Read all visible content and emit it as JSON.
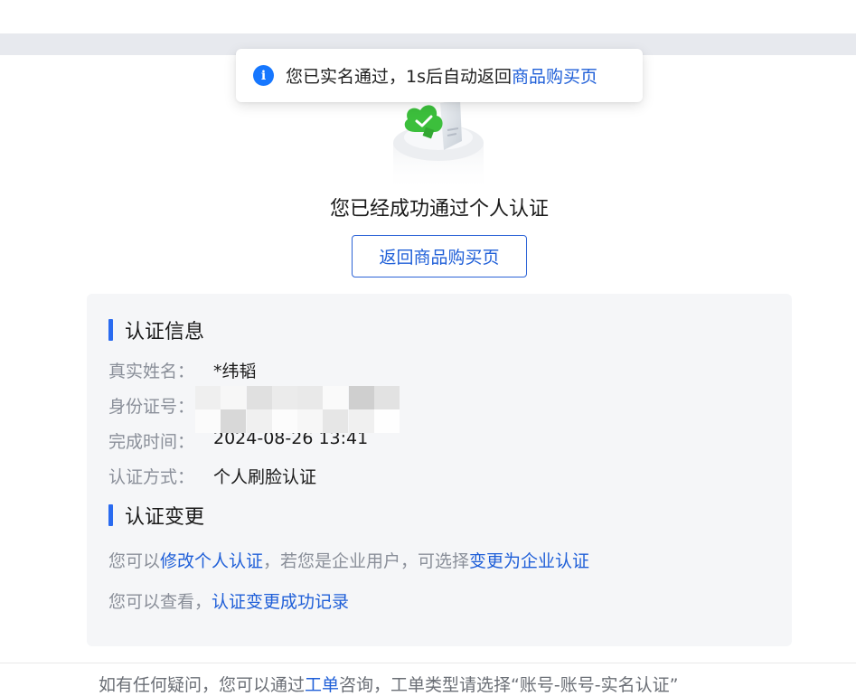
{
  "toast": {
    "message": "您已实名通过，1s后自动返回",
    "link": "商品购买页",
    "icon": "info-icon"
  },
  "illustration": {
    "icon": "verified-shield-cloud-icon",
    "accent": "#3cbf3c"
  },
  "success": {
    "title": "您已经成功通过个人认证",
    "back_button": "返回商品购买页"
  },
  "auth_info": {
    "title": "认证信息",
    "rows": [
      {
        "label": "真实姓名：",
        "value": "*纬韬"
      },
      {
        "label": "身份证号：",
        "value": ""
      },
      {
        "label": "完成时间：",
        "value": "2024-08-26 13:41"
      },
      {
        "label": "认证方式：",
        "value": "个人刷脸认证"
      }
    ]
  },
  "auth_change": {
    "title": "认证变更",
    "line1_prefix": "您可以",
    "line1_link1": "修改个人认证",
    "line1_middle": "，若您是企业用户，可选择",
    "line1_link2": "变更为企业认证",
    "line2_prefix": "您可以查看，",
    "line2_link": "认证变更成功记录"
  },
  "footer": {
    "prefix": "如有任何疑问，您可以通过",
    "link": "工单",
    "suffix": "咨询，工单类型请选择“账号-账号-实名认证”"
  },
  "colors": {
    "primary": "#1f5fd8",
    "accent_bar": "#2a6bf0",
    "panel_bg": "#f5f6f8",
    "toast_icon": "#1677ff"
  }
}
